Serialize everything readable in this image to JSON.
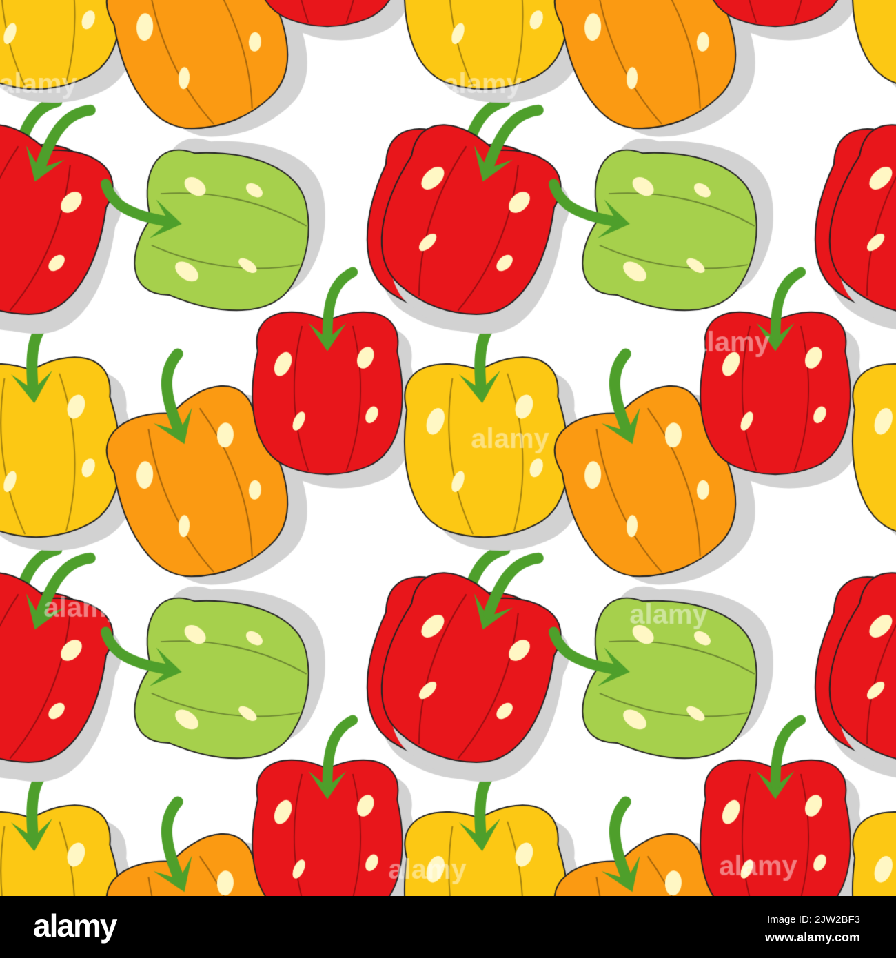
{
  "watermark": {
    "brand": "alamy"
  },
  "footer": {
    "logo": "alamy",
    "image_id": "Image ID: 2JW2BF3",
    "website": "www.alamy.com"
  },
  "colors": {
    "red": "#e8161b",
    "yellow": "#fcc814",
    "orange": "#fb9a12",
    "green": "#a6d04c",
    "stem": "#4e9f2b",
    "highlight": "#fff7c4",
    "shadow": "#d2d2d2"
  }
}
